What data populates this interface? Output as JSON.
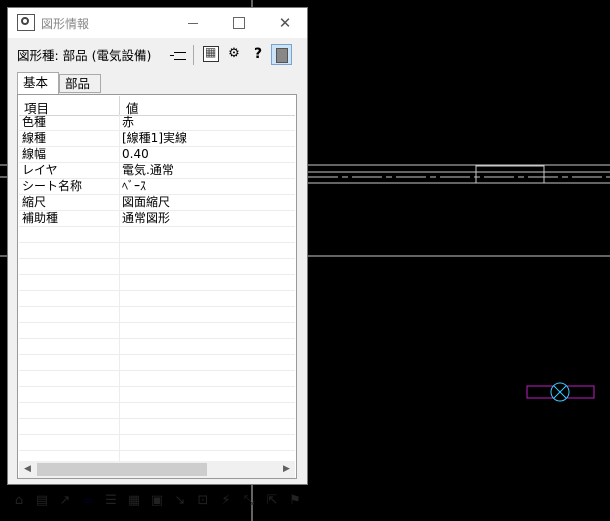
{
  "window": {
    "title": "図形情報",
    "type_label": "図形種: 部品 (電気設備)"
  },
  "tabs": [
    {
      "label": "基本"
    },
    {
      "label": "部品"
    }
  ],
  "table": {
    "headers": [
      "項目",
      "値"
    ],
    "rows": [
      {
        "item": "色種",
        "value": "赤"
      },
      {
        "item": "線種",
        "value": "[線種1]実線"
      },
      {
        "item": "線幅",
        "value": "0.40"
      },
      {
        "item": "レイヤ",
        "value": "電気.通常"
      },
      {
        "item": "シート名称",
        "value": "ﾍﾞｰｽ"
      },
      {
        "item": "縮尺",
        "value": "図面縮尺"
      },
      {
        "item": "補助種",
        "value": "通常図形"
      }
    ]
  },
  "colors": {
    "canvas": "#000000",
    "cad_lines": "#c8c8c8",
    "symbol_rect": "#c020c0",
    "symbol_circle": "#40c8ff"
  },
  "icons": {
    "titlebar": [
      "app-icon",
      "minimize-icon",
      "maximize-icon",
      "close-icon"
    ],
    "header": [
      "pin-icon",
      "grid-icon",
      "gear-icon",
      "help-icon",
      "properties-icon"
    ],
    "bottom": [
      "home-icon",
      "layer-icon",
      "line-icon",
      "fl-icon",
      "stack-icon",
      "abm-icon",
      "image-icon",
      "move-icon",
      "rotate-icon",
      "zigzag-icon",
      "dimension-icon",
      "drag-icon",
      "palette-icon"
    ]
  }
}
